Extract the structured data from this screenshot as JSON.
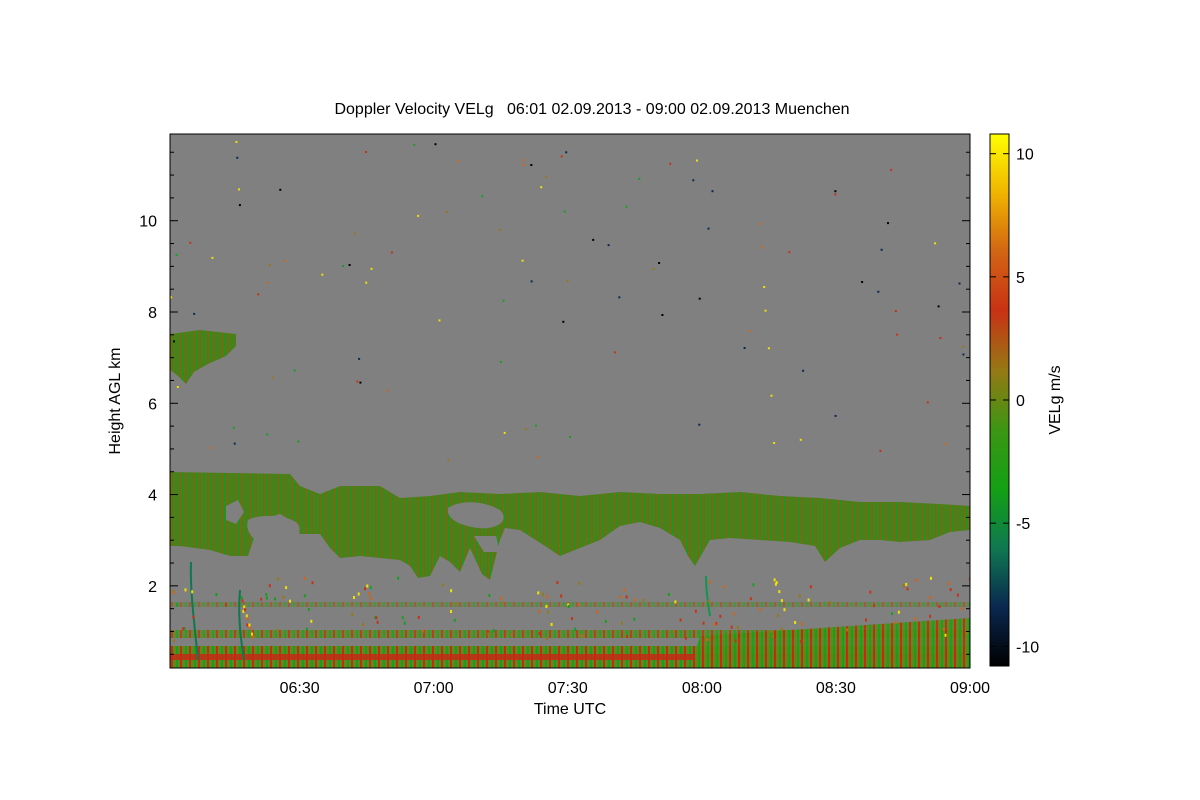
{
  "chart_data": {
    "type": "heatmap",
    "title": "Doppler Velocity VELg   06:01 02.09.2013 - 09:00 02.09.2013 Muenchen",
    "xlabel": "Time UTC",
    "ylabel": "Height AGL km",
    "x_range_minutes_utc": [
      361,
      540
    ],
    "x_ticks": [
      {
        "label": "06:30",
        "value": 390
      },
      {
        "label": "07:00",
        "value": 420
      },
      {
        "label": "07:30",
        "value": 450
      },
      {
        "label": "08:00",
        "value": 480
      },
      {
        "label": "08:30",
        "value": 510
      },
      {
        "label": "09:00",
        "value": 540
      }
    ],
    "ylim": [
      0.2,
      11.9
    ],
    "y_ticks": [
      2,
      4,
      6,
      8,
      10
    ],
    "background_color": "#808080",
    "colorbar": {
      "label": "VELg m/s",
      "range": [
        -10.8,
        10.8
      ],
      "ticks": [
        10,
        5,
        0,
        -5,
        -10
      ],
      "colors": [
        "#000000",
        "#0a2850",
        "#0f7850",
        "#14a014",
        "#3c9614",
        "#967814",
        "#c83214",
        "#d26414",
        "#f0b400",
        "#ffff00"
      ]
    },
    "layers": [
      {
        "name": "mid-level cloud layer",
        "time_start": 361,
        "time_end": 540,
        "height_base_km": 2.8,
        "height_top_km": 4.4,
        "velocity_ms": -1.5
      },
      {
        "name": "upper cloud patch",
        "time_start": 361,
        "time_end": 376,
        "height_base_km": 6.6,
        "height_top_km": 7.6,
        "velocity_ms": -1.0
      },
      {
        "name": "boundary layer returns",
        "time_start": 361,
        "time_end": 540,
        "height_base_km": 0.2,
        "height_top_km": 1.8,
        "velocity_ms": 0.5
      }
    ]
  }
}
